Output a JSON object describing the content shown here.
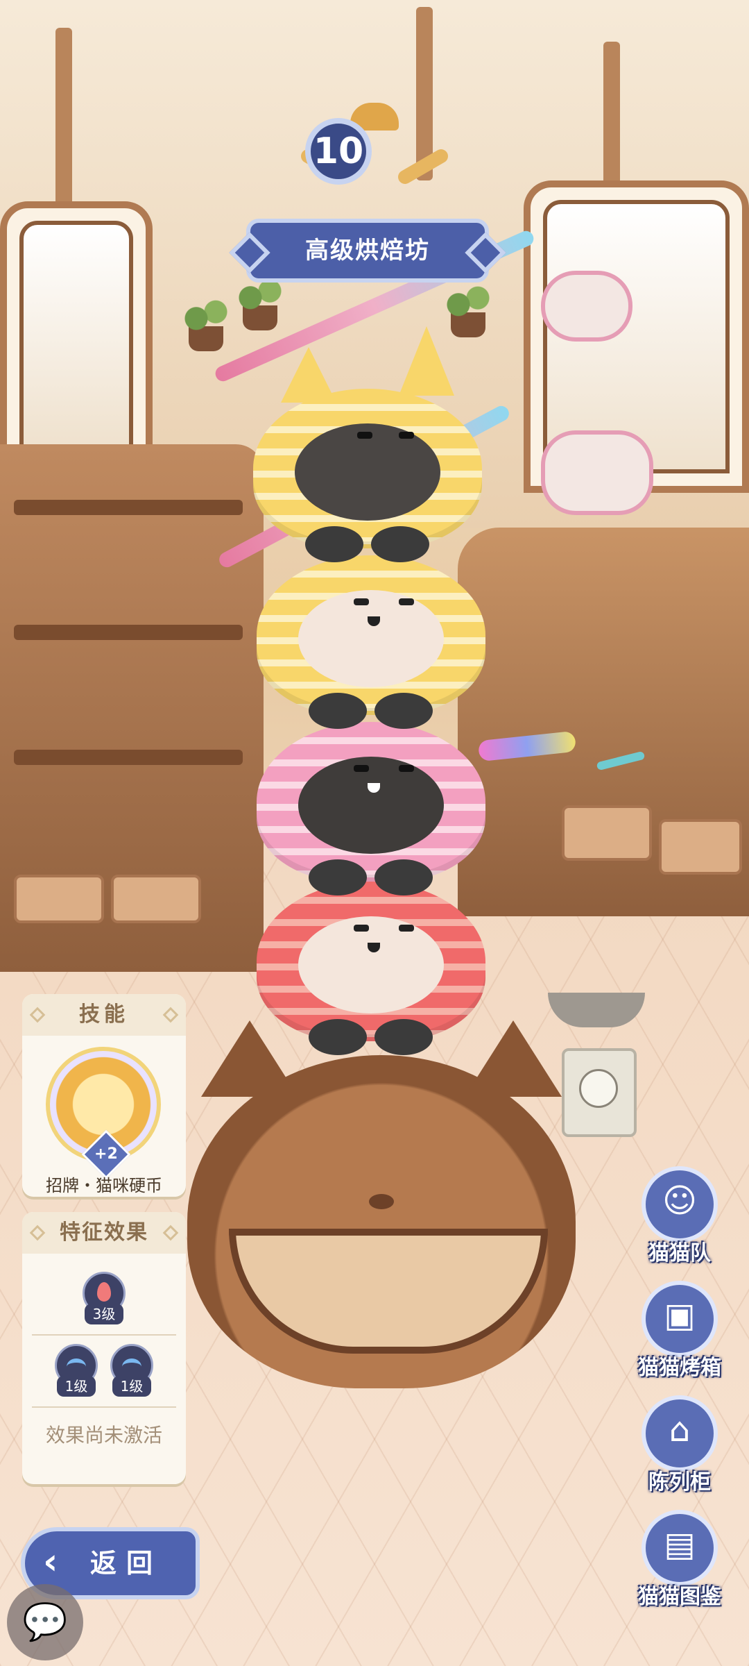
{
  "shop": {
    "level": "10",
    "title": "高级烘焙坊"
  },
  "skill_panel": {
    "header": "技能",
    "skill_name": "招牌・猫咪硬币",
    "bonus": "+2"
  },
  "trait_panel": {
    "header": "特征效果",
    "traits": [
      {
        "icon": "flame-icon",
        "level": "3级"
      },
      {
        "icon": "wave-icon",
        "level": "1级"
      },
      {
        "icon": "wind-icon",
        "level": "1级"
      }
    ],
    "status": "效果尚未激活"
  },
  "side_menu": [
    {
      "label": "猫猫队",
      "icon": "cat-team-icon"
    },
    {
      "label": "猫猫烤箱",
      "icon": "cat-oven-icon"
    },
    {
      "label": "陈列柜",
      "icon": "display-cabinet-icon"
    },
    {
      "label": "猫猫图鉴",
      "icon": "cat-encyclopedia-icon"
    }
  ],
  "back_button": {
    "label": "返回"
  },
  "colors": {
    "ui_blue": "#4f63b0",
    "panel_bg": "#fbf7ef",
    "panel_header_text": "#8a6f4f"
  }
}
